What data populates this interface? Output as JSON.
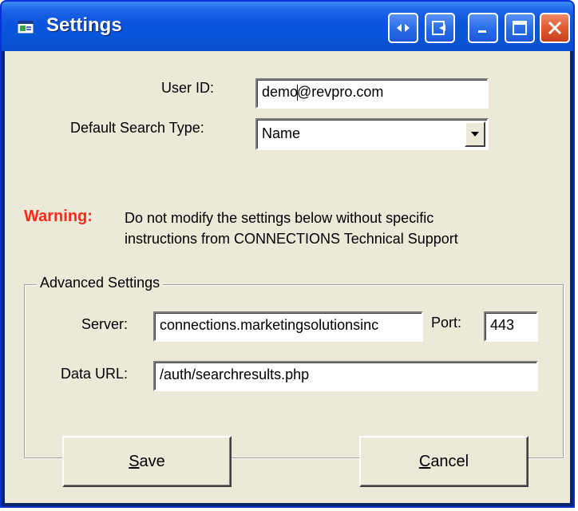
{
  "window": {
    "title": "Settings",
    "title_icon": "app-window-icon",
    "buttons": [
      "swap-icon",
      "exit-icon",
      "minimize-icon",
      "maximize-icon",
      "close-icon"
    ]
  },
  "form": {
    "user_id_label": "User ID:",
    "user_id_value_before_caret": "demo",
    "user_id_value_after_caret": "@revpro.com",
    "search_type_label": "Default Search Type:",
    "search_type_value": "Name"
  },
  "warning": {
    "label": "Warning:",
    "line1": "Do not modify the settings below without specific",
    "line2": "instructions from CONNECTIONS Technical Support",
    "color": "#ff2a1a"
  },
  "advanced": {
    "legend": "Advanced Settings",
    "server_label": "Server:",
    "server_value": "connections.marketingsolutionsinc",
    "port_label": "Port:",
    "port_value": "443",
    "data_url_label": "Data URL:",
    "data_url_value": "/auth/searchresults.php"
  },
  "actions": {
    "save_mnemonic": "S",
    "save_rest": "ave",
    "cancel_mnemonic": "C",
    "cancel_rest": "ancel"
  }
}
